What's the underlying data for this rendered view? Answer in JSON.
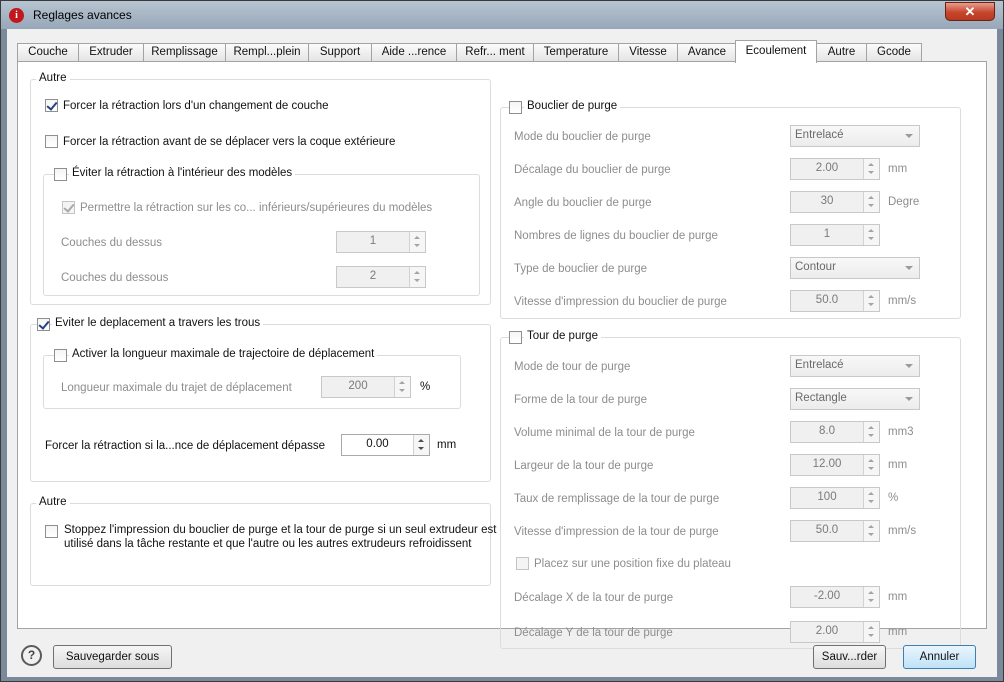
{
  "window": {
    "title": "Reglages avances",
    "app_icon": "i"
  },
  "tabs": [
    "Couche",
    "Extruder",
    "Remplissage",
    "Rempl...plein",
    "Support",
    "Aide ...rence",
    "Refr... ment",
    "Temperature",
    "Vitesse",
    "Avance",
    "Ecoulement",
    "Autre",
    "Gcode"
  ],
  "active_tab": "Ecoulement",
  "left": {
    "autre1": {
      "title": "Autre",
      "force_layer_change": {
        "label": "Forcer la rétraction lors d'un changement de couche",
        "checked": true
      },
      "force_before_outer": {
        "label": "Forcer la rétraction avant de se déplacer vers la coque extérieure",
        "checked": false
      },
      "avoid_inside": {
        "label": "Éviter la rétraction à l'intérieur des modèles",
        "checked": false,
        "allow_top_bottom": {
          "label": "Permettre la rétraction sur les co... inférieurs/supérieures du modèles",
          "checked": true
        },
        "top_layers": {
          "label": "Couches du dessus",
          "value": "1"
        },
        "bottom_layers": {
          "label": "Couches du dessous",
          "value": "2"
        }
      }
    },
    "avoid_holes": {
      "label": "Eviter le deplacement a travers les trous",
      "checked": true,
      "max_travel": {
        "label": "Activer la longueur maximale de trajectoire de déplacement",
        "checked": false,
        "length_label": "Longueur maximale du trajet de déplacement",
        "value": "200",
        "unit": "%"
      },
      "force_distance": {
        "label": "Forcer la rétraction si la...nce de déplacement dépasse",
        "value": "0.00",
        "unit": "mm"
      }
    },
    "autre2": {
      "title": "Autre",
      "stop_label_1": "Stoppez l'impression du bouclier de purge et la tour de purge si un seul extrudeur est",
      "stop_label_2": "utilisé dans la tâche restante et que l'autre ou les autres extrudeurs refroidissent",
      "checked": false
    }
  },
  "right": {
    "shield": {
      "title": "Bouclier de purge",
      "checked": false,
      "rows": [
        {
          "label": "Mode du bouclier de purge",
          "value": "Entrelacé",
          "unit": ""
        },
        {
          "label": "Décalage du bouclier de purge",
          "value": "2.00",
          "unit": "mm"
        },
        {
          "label": "Angle du bouclier de purge",
          "value": "30",
          "unit": "Degres"
        },
        {
          "label": "Nombres de lignes du bouclier de purge",
          "value": "1",
          "unit": ""
        },
        {
          "label": "Type de bouclier de purge",
          "value": "Contour",
          "unit": ""
        },
        {
          "label": "Vitesse d'impression du bouclier de purge",
          "value": "50.0",
          "unit": "mm/s"
        }
      ]
    },
    "tower": {
      "title": "Tour de purge",
      "checked": false,
      "rows": [
        {
          "label": "Mode de tour de purge",
          "value": "Entrelacé",
          "unit": ""
        },
        {
          "label": "Forme de la tour de purge",
          "value": "Rectangle",
          "unit": ""
        },
        {
          "label": "Volume minimal de la tour de purge",
          "value": "8.0",
          "unit": "mm3"
        },
        {
          "label": "Largeur de la tour de purge",
          "value": "12.00",
          "unit": "mm"
        },
        {
          "label": "Taux de remplissage de la tour de purge",
          "value": "100",
          "unit": "%"
        },
        {
          "label": "Vitesse d'impression de la tour de purge",
          "value": "50.0",
          "unit": "mm/s"
        }
      ],
      "fixed_position": {
        "label": "Placez sur une position fixe du plateau",
        "checked": false
      },
      "offset_rows": [
        {
          "label": "Décalage X de la tour de purge",
          "value": "-2.00",
          "unit": "mm"
        },
        {
          "label": "Décalage Y de la tour de purge",
          "value": "2.00",
          "unit": "mm"
        }
      ]
    }
  },
  "footer": {
    "help_icon": "?",
    "save_as": "Sauvegarder sous",
    "save": "Sauv...rder",
    "cancel": "Annuler"
  }
}
